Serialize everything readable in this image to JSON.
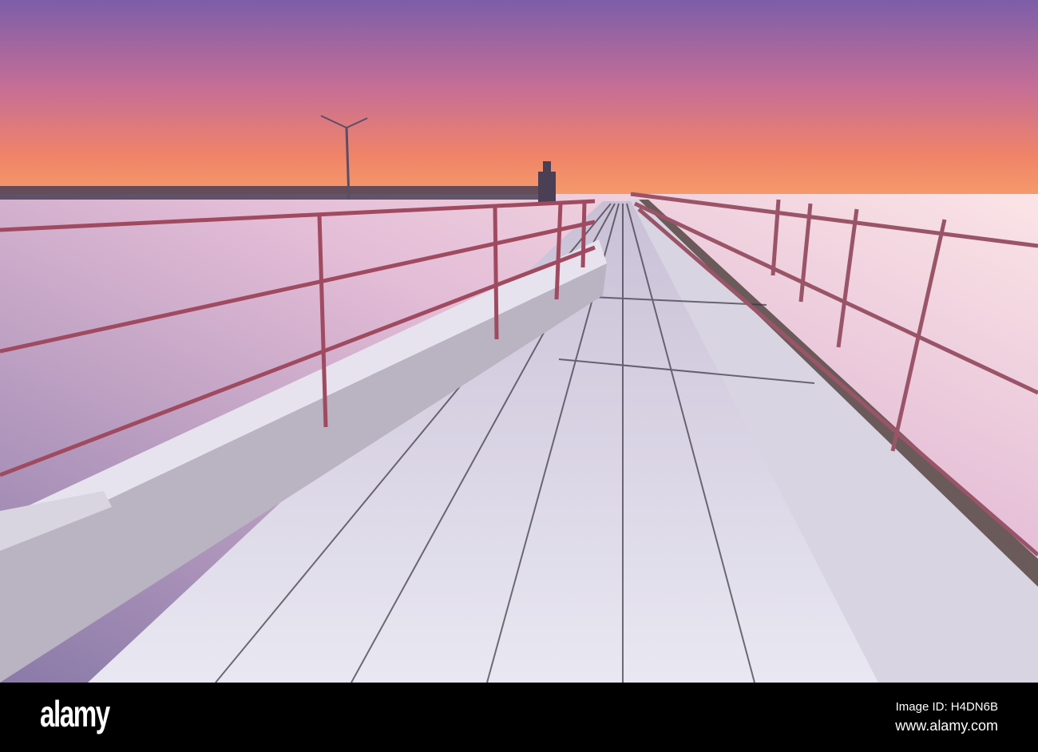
{
  "photo": {
    "subject": "pier",
    "colors": {
      "sky_top": "#7c5ea8",
      "sky_mid": "#d9708e",
      "horizon": "#f5865c",
      "sea_far": "#f6c9d5",
      "sea_near": "#8d7aa9",
      "deck": "#e4e2ee",
      "rail": "#a04a60"
    }
  },
  "footer": {
    "logo": "alamy",
    "image_id": "Image ID: H4DN6B",
    "website": "www.alamy.com"
  }
}
